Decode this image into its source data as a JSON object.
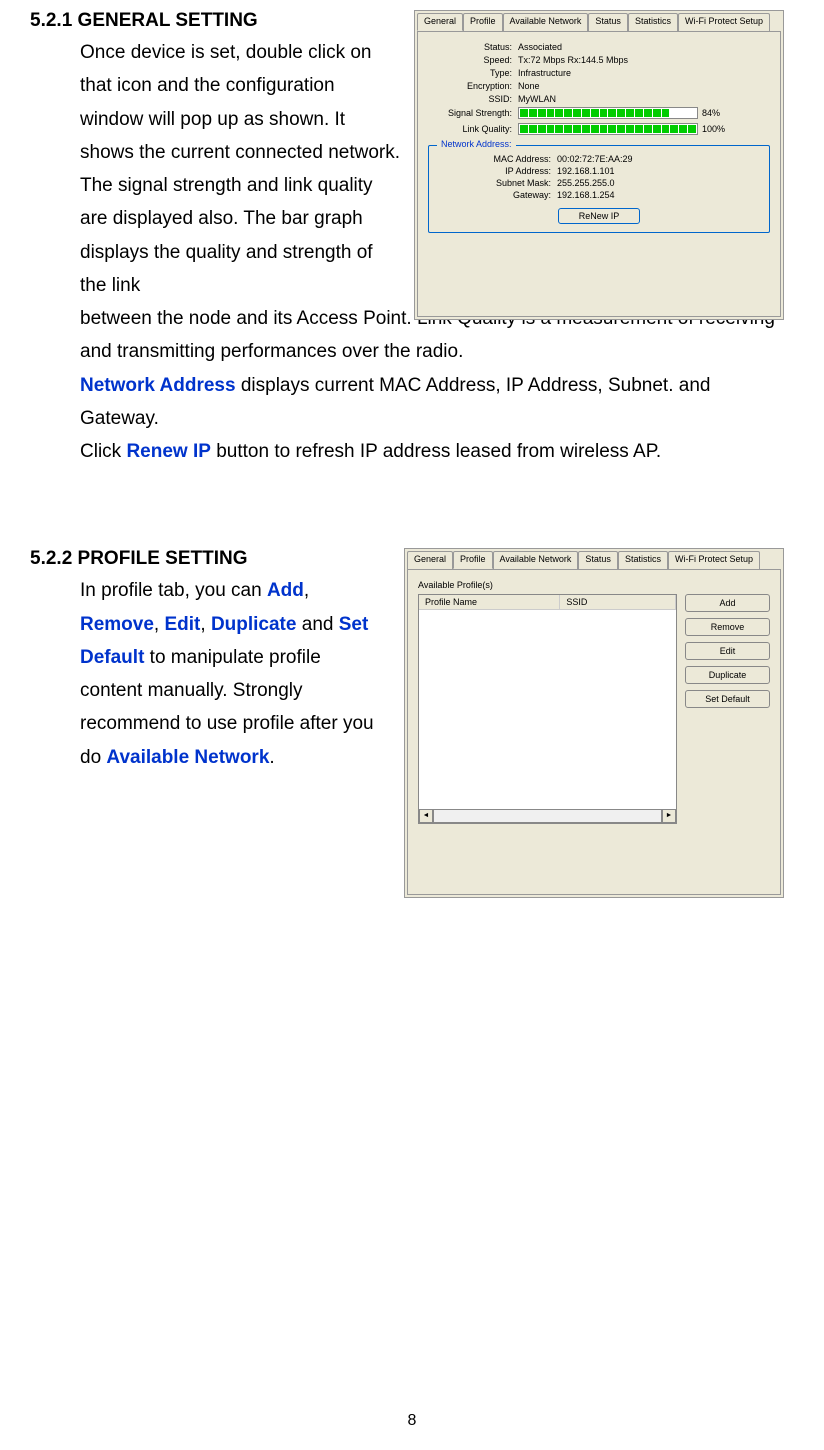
{
  "section1": {
    "heading": "5.2.1 GENERAL SETTING",
    "para1a": "Once device is set, double click on that icon and the configuration window will pop up as shown. It shows the current connected network. The signal strength and link quality are displayed also. The bar graph displays the quality and strength of the link",
    "para1b": "between the node and its Access Point. Link Quality is a measurement of receiving and transmitting performances over the radio.",
    "networkAddressLabel": "Network Address",
    "para2": " displays current MAC Address, IP Address, Subnet. and Gateway.",
    "clickText": "Click ",
    "renewIPLabel": "Renew IP",
    "para3": " button to refresh IP address leased from wireless AP."
  },
  "section2": {
    "heading": "5.2.2 PROFILE SETTING",
    "para1": "In profile tab, you can ",
    "addLabel": "Add",
    "removeLabel": "Remove",
    "editLabel": "Edit",
    "duplicateLabel": "Duplicate",
    "andText": " and ",
    "setDefaultLabel": "Set Default",
    "para2": " to manipulate profile content manually. Strongly recommend to use profile after you do ",
    "availableNetworkLabel": "Available Network",
    "period": "."
  },
  "screenshot1": {
    "tabs": [
      "General",
      "Profile",
      "Available Network",
      "Status",
      "Statistics",
      "Wi-Fi Protect Setup"
    ],
    "activeTab": "General",
    "statusLabel": "Status:",
    "statusValue": "Associated",
    "speedLabel": "Speed:",
    "speedValue": "Tx:72 Mbps Rx:144.5 Mbps",
    "typeLabel": "Type:",
    "typeValue": "Infrastructure",
    "encryptionLabel": "Encryption:",
    "encryptionValue": "None",
    "ssidLabel": "SSID:",
    "ssidValue": "MyWLAN",
    "signalStrengthLabel": "Signal Strength:",
    "signalStrengthPct": "84%",
    "linkQualityLabel": "Link Quality:",
    "linkQualityPct": "100%",
    "networkAddressTitle": "Network Address:",
    "macLabel": "MAC Address:",
    "macValue": "00:02:72:7E:AA:29",
    "ipLabel": "IP Address:",
    "ipValue": "192.168.1.101",
    "subnetLabel": "Subnet Mask:",
    "subnetValue": "255.255.255.0",
    "gatewayLabel": "Gateway:",
    "gatewayValue": "192.168.1.254",
    "renewBtn": "ReNew IP"
  },
  "screenshot2": {
    "tabs": [
      "General",
      "Profile",
      "Available Network",
      "Status",
      "Statistics",
      "Wi-Fi Protect Setup"
    ],
    "activeTab": "Profile",
    "availableProfilesLabel": "Available Profile(s)",
    "col1": "Profile Name",
    "col2": "SSID",
    "buttons": [
      "Add",
      "Remove",
      "Edit",
      "Duplicate",
      "Set Default"
    ]
  },
  "pageNumber": "8"
}
